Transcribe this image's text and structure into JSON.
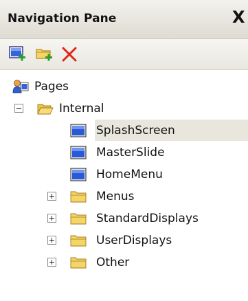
{
  "pane": {
    "title": "Navigation Pane",
    "close_glyph": "X"
  },
  "toolbar": {
    "buttons": [
      {
        "name": "add-page-icon"
      },
      {
        "name": "add-folder-icon"
      },
      {
        "name": "delete-icon"
      }
    ]
  },
  "tree": {
    "root": {
      "label": "Pages",
      "icon": "pages-icon"
    },
    "internal": {
      "label": "Internal",
      "icon": "folder-open-icon",
      "expanded": true
    },
    "pages": [
      {
        "label": "SplashScreen",
        "icon": "page-icon",
        "selected": true
      },
      {
        "label": "MasterSlide",
        "icon": "page-icon"
      },
      {
        "label": "HomeMenu",
        "icon": "page-icon"
      }
    ],
    "folders": [
      {
        "label": "Menus",
        "icon": "folder-icon"
      },
      {
        "label": "StandardDisplays",
        "icon": "folder-icon"
      },
      {
        "label": "UserDisplays",
        "icon": "folder-icon"
      },
      {
        "label": "Other",
        "icon": "folder-icon"
      }
    ]
  },
  "colors": {
    "selection": "#e8e6dd",
    "folder": "#f3d56a",
    "page_blue": "#2a59d8",
    "delete_red": "#e0261b"
  }
}
